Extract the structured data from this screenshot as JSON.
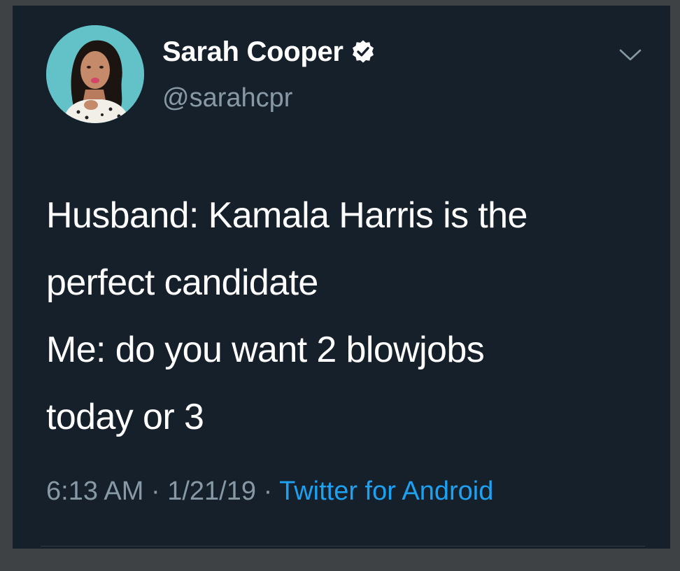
{
  "tweet": {
    "author": {
      "name": "Sarah Cooper",
      "handle": "@sarahcpr",
      "verified": true
    },
    "text_lines": [
      "Husband: Kamala Harris is the",
      "perfect candidate",
      "Me: do you want 2 blowjobs",
      "today or 3"
    ],
    "time": "6:13 AM",
    "separator": "·",
    "date": "1/21/19",
    "source": "Twitter for Android"
  },
  "colors": {
    "background": "#16202b",
    "outer_frame": "#3f4245",
    "text_primary": "#ffffff",
    "text_secondary": "#8899a6",
    "accent": "#1da1f2"
  },
  "icons": {
    "verified": "verified-badge-icon",
    "menu": "chevron-down-icon"
  }
}
